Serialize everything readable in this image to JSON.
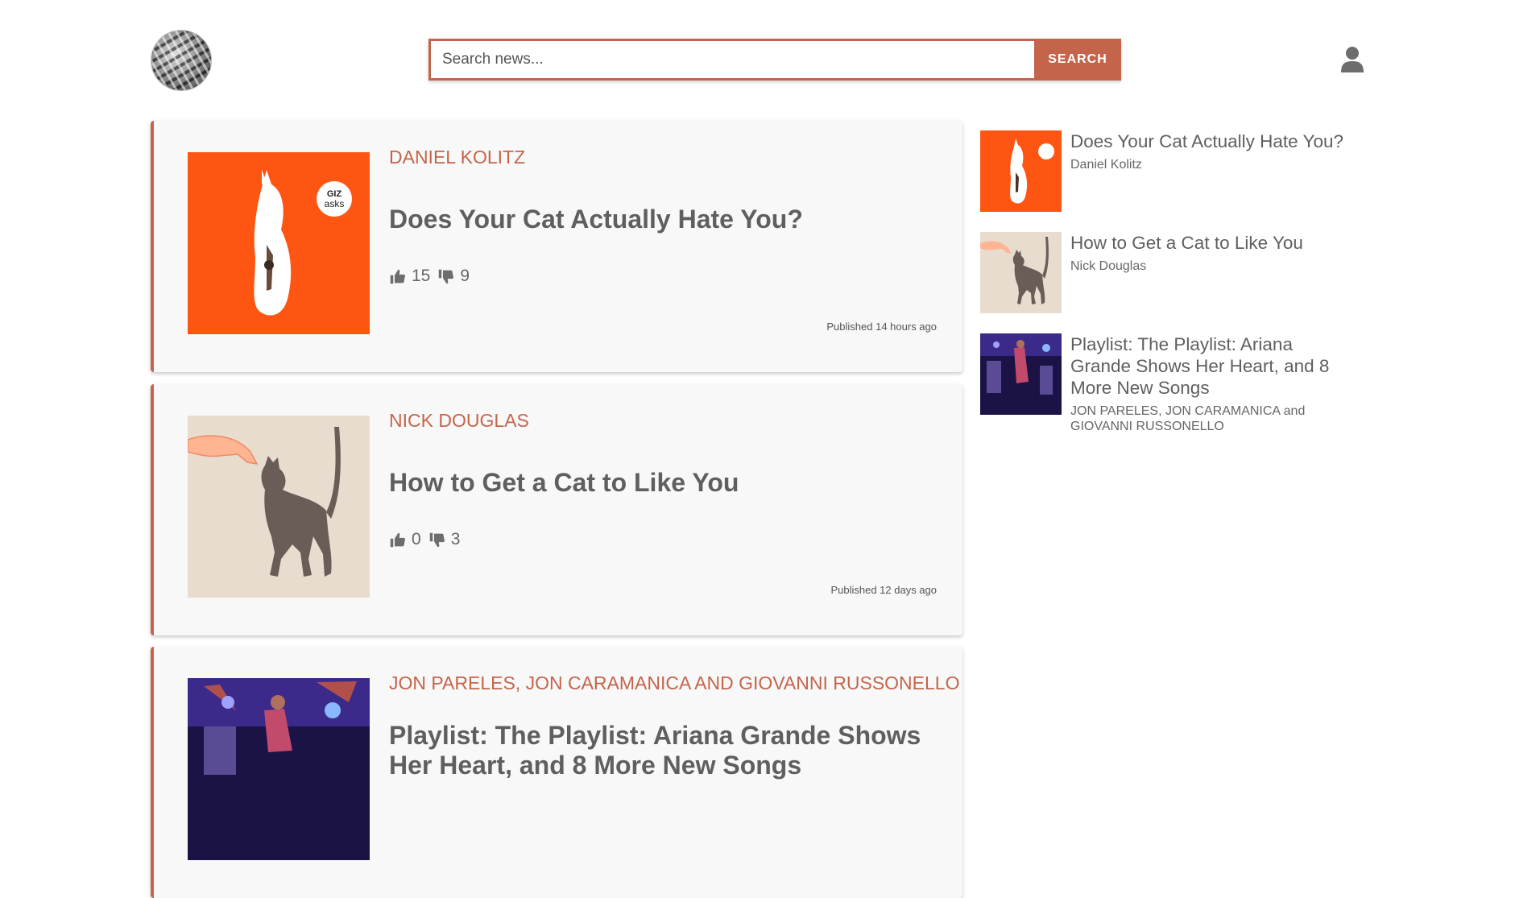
{
  "header": {
    "logo": "site-logo",
    "search": {
      "placeholder": "Search news...",
      "value": "",
      "button_label": "SEARCH"
    },
    "user_icon": "user-icon"
  },
  "colors": {
    "accent": "#c4654b",
    "card_bg": "#f8f8f8",
    "text": "#5f5f5f"
  },
  "articles": [
    {
      "author": "DANIEL KOLITZ",
      "title": "Does Your Cat Actually Hate You?",
      "likes": "15",
      "dislikes": "9",
      "published": "Published 14 hours ago",
      "image": "orange-cat-illustration"
    },
    {
      "author": "NICK DOUGLAS",
      "title": "How to Get a Cat to Like You",
      "likes": "0",
      "dislikes": "3",
      "published": "Published 12 days ago",
      "image": "hand-and-cat-illustration"
    },
    {
      "author": "JON PARELES, JON CARAMANICA AND GIOVANNI RUSSONELLO",
      "title": "Playlist: The Playlist: Ariana Grande Shows Her Heart, and 8 More New Songs",
      "image": "concert-stage-photo"
    }
  ],
  "sidebar": [
    {
      "title": "Does Your Cat Actually Hate You?",
      "author": "Daniel Kolitz"
    },
    {
      "title": "How to Get a Cat to Like You",
      "author": "Nick Douglas"
    },
    {
      "title": "Playlist: The Playlist: Ariana Grande Shows Her Heart, and 8 More New Songs",
      "author": "JON PARELES, JON CARAMANICA and GIOVANNI RUSSONELLO"
    }
  ]
}
